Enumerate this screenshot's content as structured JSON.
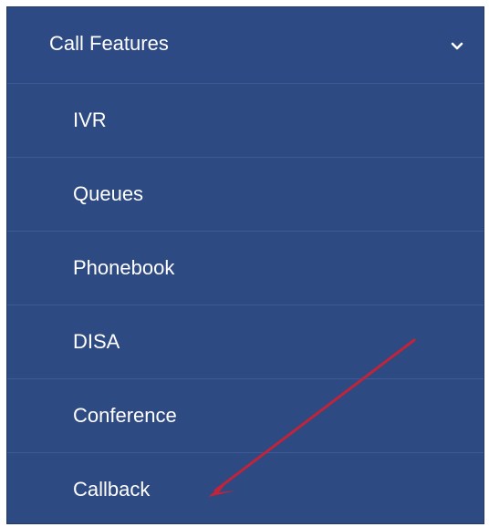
{
  "menu": {
    "header": {
      "label": "Call Features",
      "icon": "chevron-down-icon"
    },
    "items": [
      {
        "label": "IVR"
      },
      {
        "label": "Queues"
      },
      {
        "label": "Phonebook"
      },
      {
        "label": "DISA"
      },
      {
        "label": "Conference"
      },
      {
        "label": "Callback"
      }
    ]
  },
  "colors": {
    "menu_background": "#2e4a82",
    "divider": "#3d5b95",
    "text": "#ffffff",
    "annotation_arrow": "#c0243a"
  }
}
